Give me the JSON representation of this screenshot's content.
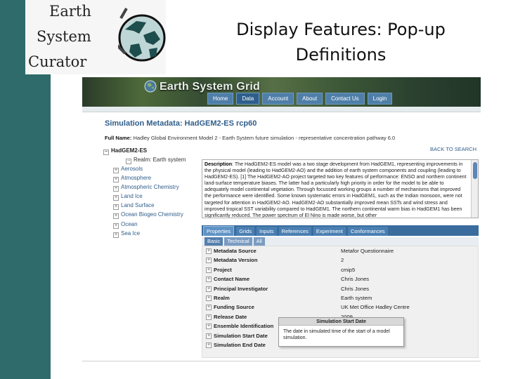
{
  "slide": {
    "logo_line1": "Earth",
    "logo_line2": "System",
    "logo_line3": "Curator",
    "title_line1": "Display Features: Pop-up",
    "title_line2": "Definitions",
    "accent_color": "#2f6b6b"
  },
  "portal": {
    "banner_title": "Earth System Grid",
    "nav": [
      "Home",
      "Data",
      "Account",
      "About",
      "Contact Us",
      "Login"
    ],
    "nav_active": "Data",
    "sim_title": "Simulation Metadata: HadGEM2-ES rcp60",
    "full_name_label": "Full Name:",
    "full_name_value": "Hadley Global Environment Model 2 - Earth System future simulation - representative concentration pathway 6.0",
    "back_link": "BACK TO SEARCH",
    "tree": {
      "root": "HadGEM2-ES",
      "realm": "Realm: Earth system",
      "items": [
        "Aerosols",
        "Atmosphere",
        "Atmospheric Chemistry",
        "Land Ice",
        "Land Surface",
        "Ocean Biogeo Chemistry",
        "Ocean",
        "Sea Ice"
      ]
    },
    "description_label": "Description",
    "description": ": The HadGEM2-ES model was a two stage development from HadGEM1, representing improvements in the physical model (leading to HadGEM2-AO) and the addition of earth system components and coupling (leading to HadGEM2-ES). [1] The HadGEM2-AO project targeted two key features of performance: ENSO and northern continent land-surface temperature biases. The latter had a particularly high priority in order for the model to be able to adequately model continental vegetation. Through focussed working groups a number of mechanisms that improved the performance were identified. Some known systematic errors in HadGEM1, such as the Indian monsoon, were not targeted for attention in HadGEM2-AO. HadGEM2-AO substantially improved mean SSTs and wind stress and improved tropical SST variability compared to HadGEM1. The northern continental warm bias in HadGEM1 has been significantly reduced. The power spectrum of El Nino is made worse, but other",
    "tabs": [
      "Properties",
      "Grids",
      "Inputs",
      "References",
      "Experiment",
      "Conformances"
    ],
    "tab_active": "Properties",
    "subtabs": [
      "Basic",
      "Technical",
      "All"
    ],
    "subtab_active": "Basic",
    "properties": [
      {
        "key": "Metadata Source",
        "value": "Metafor Questionnaire"
      },
      {
        "key": "Metadata Version",
        "value": "2"
      },
      {
        "key": "Project",
        "value": "cmip5"
      },
      {
        "key": "Contact Name",
        "value": "Chris Jones"
      },
      {
        "key": "Principal Investigator",
        "value": "Chris Jones"
      },
      {
        "key": "Realm",
        "value": "Earth system"
      },
      {
        "key": "Funding Source",
        "value": "UK Met Office Hadley Centre"
      },
      {
        "key": "Release Date",
        "value": "2009"
      },
      {
        "key": "Ensemble Identification",
        "value": ""
      },
      {
        "key": "Simulation Start Date",
        "value": ""
      },
      {
        "key": "Simulation End Date",
        "value": ""
      }
    ],
    "tooltip": {
      "title": "Simulation Start Date",
      "text": "The date in simulated time of the start of a model simulation."
    }
  }
}
